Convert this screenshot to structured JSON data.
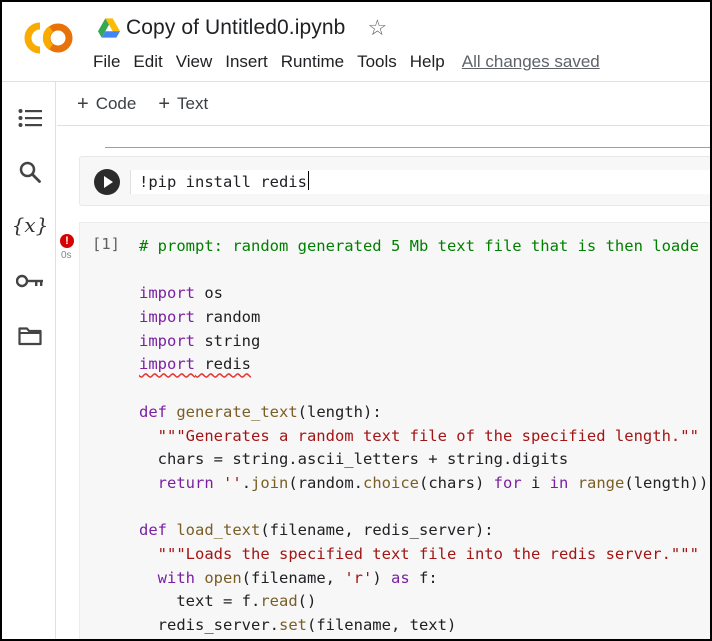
{
  "header": {
    "title": "Copy of Untitled0.ipynb",
    "menu": [
      "File",
      "Edit",
      "View",
      "Insert",
      "Runtime",
      "Tools",
      "Help"
    ],
    "save_status": "All changes saved",
    "logo_text": "CO",
    "logo_colors": [
      "#f9ab00",
      "#e8710a"
    ]
  },
  "toolbar": {
    "add_code": "Code",
    "add_text": "Text"
  },
  "sidebar": {
    "items": [
      "table-of-contents-icon",
      "search-icon",
      "variables-icon",
      "key-icon",
      "folder-icon"
    ],
    "variables_symbol": "{x}"
  },
  "cells": {
    "pip": {
      "code": "!pip install redis"
    },
    "main": {
      "exec_count": "[1]",
      "status": "!",
      "exec_time": "0s",
      "lines": [
        "# prompt: random generated 5 Mb text file that is then loade",
        "",
        "import os",
        "import random",
        "import string",
        "import redis",
        "",
        "def generate_text(length):",
        "  \"\"\"Generates a random text file of the specified length.\"\"",
        "  chars = string.ascii_letters + string.digits",
        "  return ''.join(random.choice(chars) for i in range(length))",
        "",
        "def load_text(filename, redis_server):",
        "  \"\"\"Loads the specified text file into the redis server.\"\"\"",
        "  with open(filename, 'r') as f:",
        "    text = f.read()",
        "  redis_server.set(filename, text)"
      ]
    }
  }
}
